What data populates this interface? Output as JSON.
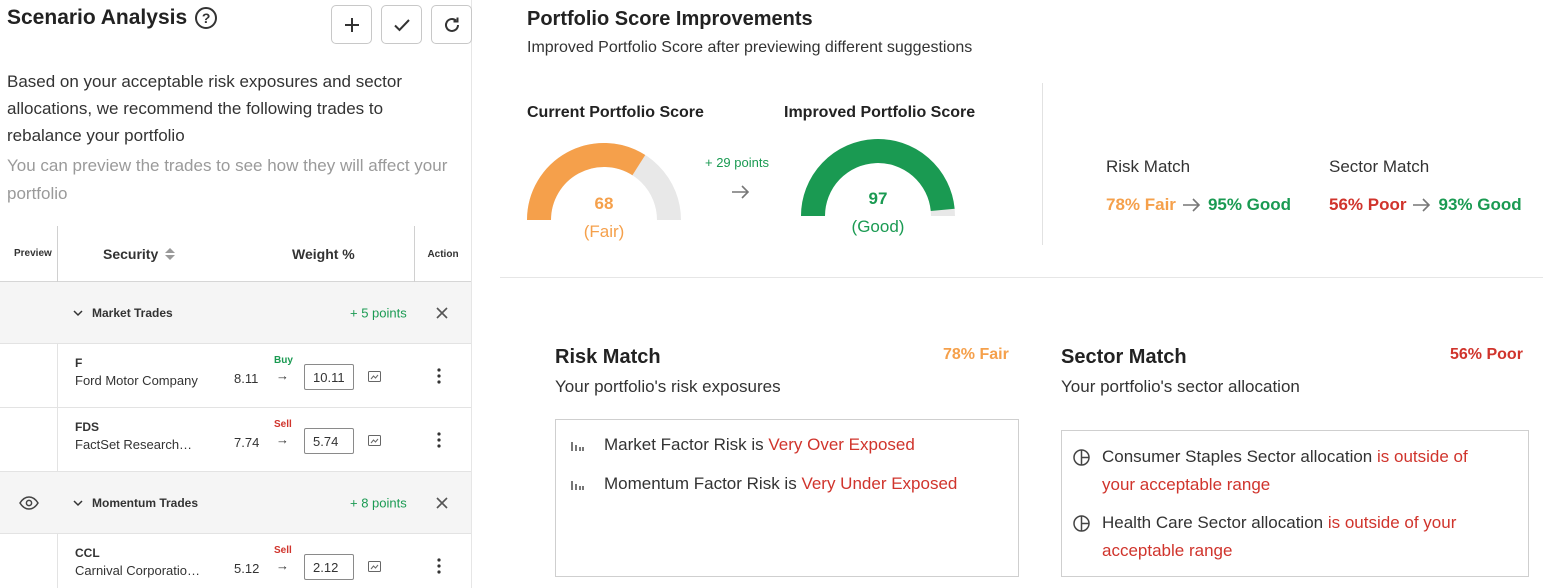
{
  "scenario": {
    "title": "Scenario Analysis",
    "description": "Based on your acceptable risk exposures and sector allocations, we recommend the following trades to rebalance your portfolio",
    "hint": "You can preview the trades to see how they will affect your portfolio"
  },
  "table": {
    "headers": {
      "preview": "Preview",
      "security": "Security",
      "weight": "Weight %",
      "action": "Action"
    },
    "groups": [
      {
        "label": "Market Trades",
        "points": "+ 5 points",
        "trades": [
          {
            "ticker": "F",
            "company": "Ford Motor Company",
            "current": "8.11",
            "type": "Buy",
            "new": "10.11"
          },
          {
            "ticker": "FDS",
            "company": "FactSet Research…",
            "current": "7.74",
            "type": "Sell",
            "new": "5.74"
          }
        ]
      },
      {
        "label": "Momentum Trades",
        "points": "+ 8 points",
        "trades": [
          {
            "ticker": "CCL",
            "company": "Carnival Corporatio…",
            "current": "5.12",
            "type": "Sell",
            "new": "2.12"
          }
        ]
      }
    ],
    "arrow": "→"
  },
  "improvements": {
    "title": "Portfolio Score Improvements",
    "subtitle": "Improved Portfolio Score after previewing different suggestions",
    "current_label": "Current Portfolio Score",
    "improved_label": "Improved Portfolio Score",
    "current_score": "68",
    "current_rating": "(Fair)",
    "current_value": 68,
    "improved_score": "97",
    "improved_rating": "(Good)",
    "improved_value": 97,
    "points_gain": "+ 29 points",
    "risk_match": {
      "label": "Risk Match",
      "from": "78% Fair",
      "to": "95% Good"
    },
    "sector_match": {
      "label": "Sector Match",
      "from": "56% Poor",
      "to": "93% Good"
    }
  },
  "risk_card": {
    "title": "Risk Match",
    "badge": "78% Fair",
    "subtitle": "Your portfolio's risk exposures",
    "items": [
      {
        "text": "Market Factor Risk is ",
        "highlight": "Very Over Exposed"
      },
      {
        "text": "Momentum Factor Risk is ",
        "highlight": "Very Under Exposed"
      }
    ]
  },
  "sector_card": {
    "title": "Sector Match",
    "badge": "56% Poor",
    "subtitle": "Your portfolio's sector allocation",
    "items": [
      {
        "line1": "Consumer Staples Sector allocation ",
        "hl1": "is outside of",
        "hl2": "your acceptable range"
      },
      {
        "line1": "Health Care Sector allocation ",
        "hl1": "is outside of your",
        "hl2": "acceptable range"
      }
    ]
  },
  "colors": {
    "fair": "#f5a04b",
    "good": "#1a9a52",
    "poor": "#d0342c",
    "track": "#e8e8e8"
  }
}
